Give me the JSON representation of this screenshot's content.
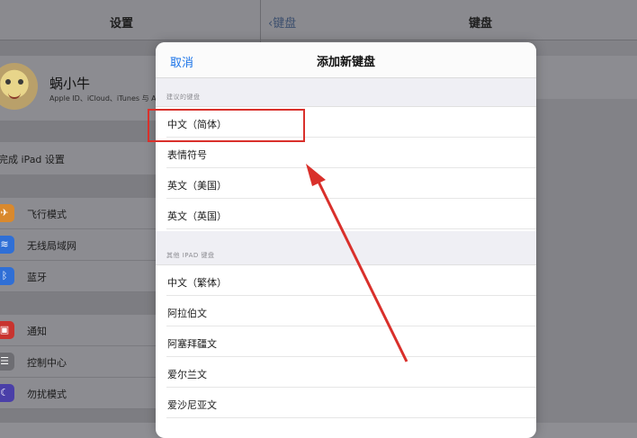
{
  "background": {
    "left_title": "设置",
    "right_back": "键盘",
    "right_title": "键盘",
    "top_cut_text": "设置",
    "profile": {
      "name": "蜗小牛",
      "subtitle": "Apple ID、iCloud、iTunes 与 App Store"
    },
    "finish_setup": "完成 iPad 设置",
    "groups": [
      [
        {
          "label": "飞行模式",
          "icon": "airplane-icon",
          "color": "#d9892d"
        },
        {
          "label": "无线局域网",
          "icon": "wifi-icon",
          "color": "#2f6fd6"
        },
        {
          "label": "蓝牙",
          "icon": "bluetooth-icon",
          "color": "#2f6fd6"
        }
      ],
      [
        {
          "label": "通知",
          "icon": "notifications-icon",
          "color": "#c8342f"
        },
        {
          "label": "控制中心",
          "icon": "control-center-icon",
          "color": "#6d6d72"
        },
        {
          "label": "勿扰模式",
          "icon": "moon-icon",
          "color": "#4a3fa8"
        }
      ]
    ]
  },
  "sheet": {
    "cancel_label": "取消",
    "title": "添加新键盘",
    "suggested_header": "建议的键盘",
    "suggested": [
      "中文（简体）",
      "表情符号",
      "英文（美国）",
      "英文（英国）"
    ],
    "other_header": "其他 IPAD 键盘",
    "other": [
      "中文（繁体）",
      "阿拉伯文",
      "阿塞拜疆文",
      "爱尔兰文",
      "爱沙尼亚文"
    ]
  },
  "colors": {
    "accent": "#1a73e8",
    "annotation": "#d9302b"
  }
}
